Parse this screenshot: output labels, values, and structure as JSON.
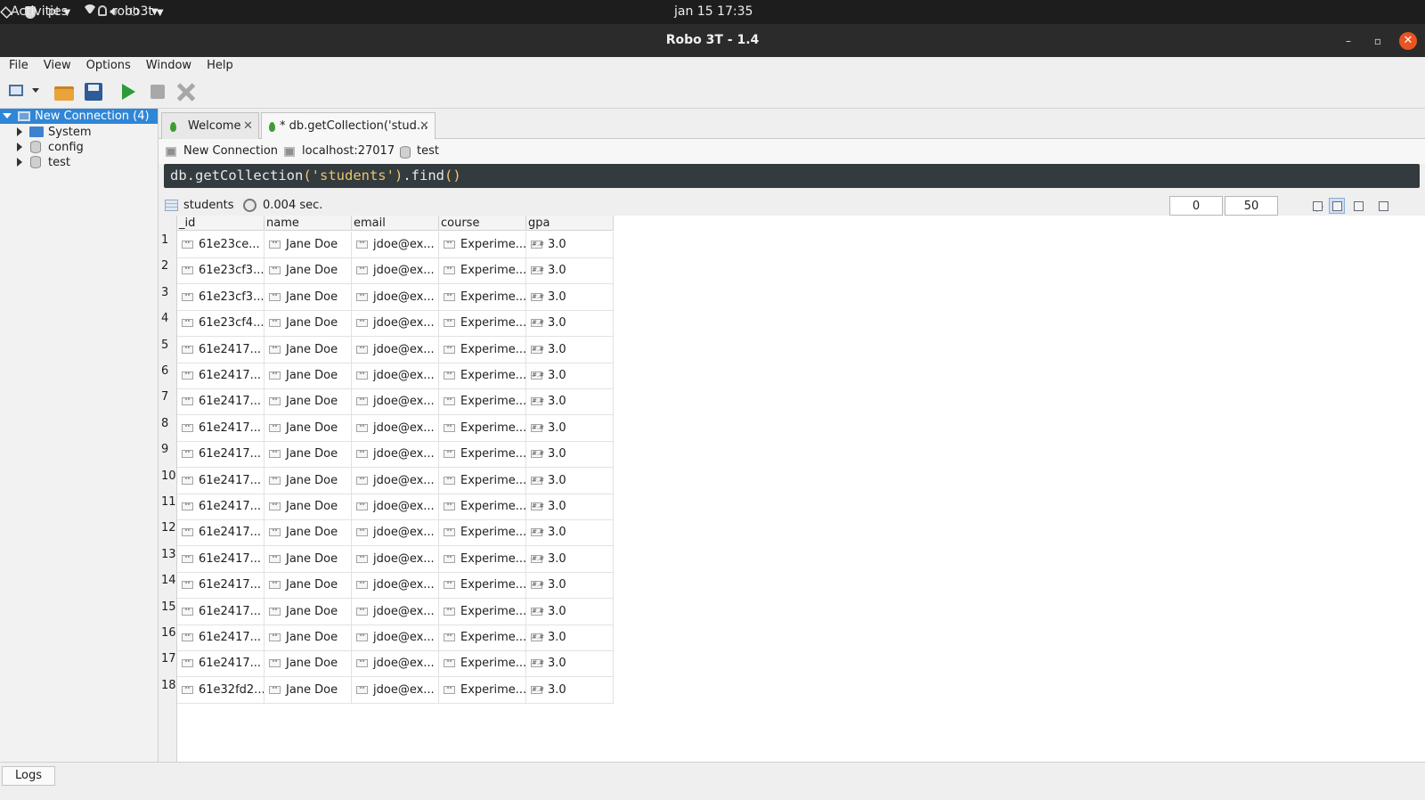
{
  "system_bar": {
    "activities": "Activities",
    "app_name": "robo3t",
    "clock": "jan 15  17:35",
    "input_method": "pt"
  },
  "window": {
    "title": "Robo 3T - 1.4"
  },
  "menu": {
    "items": [
      "File",
      "View",
      "Options",
      "Window",
      "Help"
    ]
  },
  "explorer": {
    "connection": "New Connection (4)",
    "children": [
      "System",
      "config",
      "test"
    ]
  },
  "tabs": [
    {
      "label": "Welcome"
    },
    {
      "label": "* db.getCollection('stud..."
    }
  ],
  "query_info": {
    "connection": "New Connection",
    "host": "localhost:27017",
    "database": "test"
  },
  "editor": {
    "prefix": "db.getCollection",
    "paren_open": "(",
    "string": "'students'",
    "paren_close": ")",
    "method": ".find",
    "call": "()"
  },
  "results": {
    "collection": "students",
    "elapsed": "0.004 sec.",
    "page_start": "0",
    "page_size": "50",
    "columns": [
      "_id",
      "name",
      "email",
      "course",
      "gpa"
    ],
    "type_icons": {
      "string": "\"\"",
      "number": "#.#"
    },
    "rows": [
      [
        "1",
        "61e23ce...",
        "Jane Doe",
        "jdoe@ex...",
        "Experime...",
        "3.0"
      ],
      [
        "2",
        "61e23cf3...",
        "Jane Doe",
        "jdoe@ex...",
        "Experime...",
        "3.0"
      ],
      [
        "3",
        "61e23cf3...",
        "Jane Doe",
        "jdoe@ex...",
        "Experime...",
        "3.0"
      ],
      [
        "4",
        "61e23cf4...",
        "Jane Doe",
        "jdoe@ex...",
        "Experime...",
        "3.0"
      ],
      [
        "5",
        "61e2417...",
        "Jane Doe",
        "jdoe@ex...",
        "Experime...",
        "3.0"
      ],
      [
        "6",
        "61e2417...",
        "Jane Doe",
        "jdoe@ex...",
        "Experime...",
        "3.0"
      ],
      [
        "7",
        "61e2417...",
        "Jane Doe",
        "jdoe@ex...",
        "Experime...",
        "3.0"
      ],
      [
        "8",
        "61e2417...",
        "Jane Doe",
        "jdoe@ex...",
        "Experime...",
        "3.0"
      ],
      [
        "9",
        "61e2417...",
        "Jane Doe",
        "jdoe@ex...",
        "Experime...",
        "3.0"
      ],
      [
        "10",
        "61e2417...",
        "Jane Doe",
        "jdoe@ex...",
        "Experime...",
        "3.0"
      ],
      [
        "11",
        "61e2417...",
        "Jane Doe",
        "jdoe@ex...",
        "Experime...",
        "3.0"
      ],
      [
        "12",
        "61e2417...",
        "Jane Doe",
        "jdoe@ex...",
        "Experime...",
        "3.0"
      ],
      [
        "13",
        "61e2417...",
        "Jane Doe",
        "jdoe@ex...",
        "Experime...",
        "3.0"
      ],
      [
        "14",
        "61e2417...",
        "Jane Doe",
        "jdoe@ex...",
        "Experime...",
        "3.0"
      ],
      [
        "15",
        "61e2417...",
        "Jane Doe",
        "jdoe@ex...",
        "Experime...",
        "3.0"
      ],
      [
        "16",
        "61e2417...",
        "Jane Doe",
        "jdoe@ex...",
        "Experime...",
        "3.0"
      ],
      [
        "17",
        "61e2417...",
        "Jane Doe",
        "jdoe@ex...",
        "Experime...",
        "3.0"
      ],
      [
        "18",
        "61e32fd2...",
        "Jane Doe",
        "jdoe@ex...",
        "Experime...",
        "3.0"
      ]
    ]
  },
  "logs": {
    "label": "Logs"
  },
  "colors": {
    "selection": "#2f86d6",
    "run_green": "#2e9a3a",
    "close_orange": "#e95420",
    "editor_bg": "#333b3f"
  }
}
